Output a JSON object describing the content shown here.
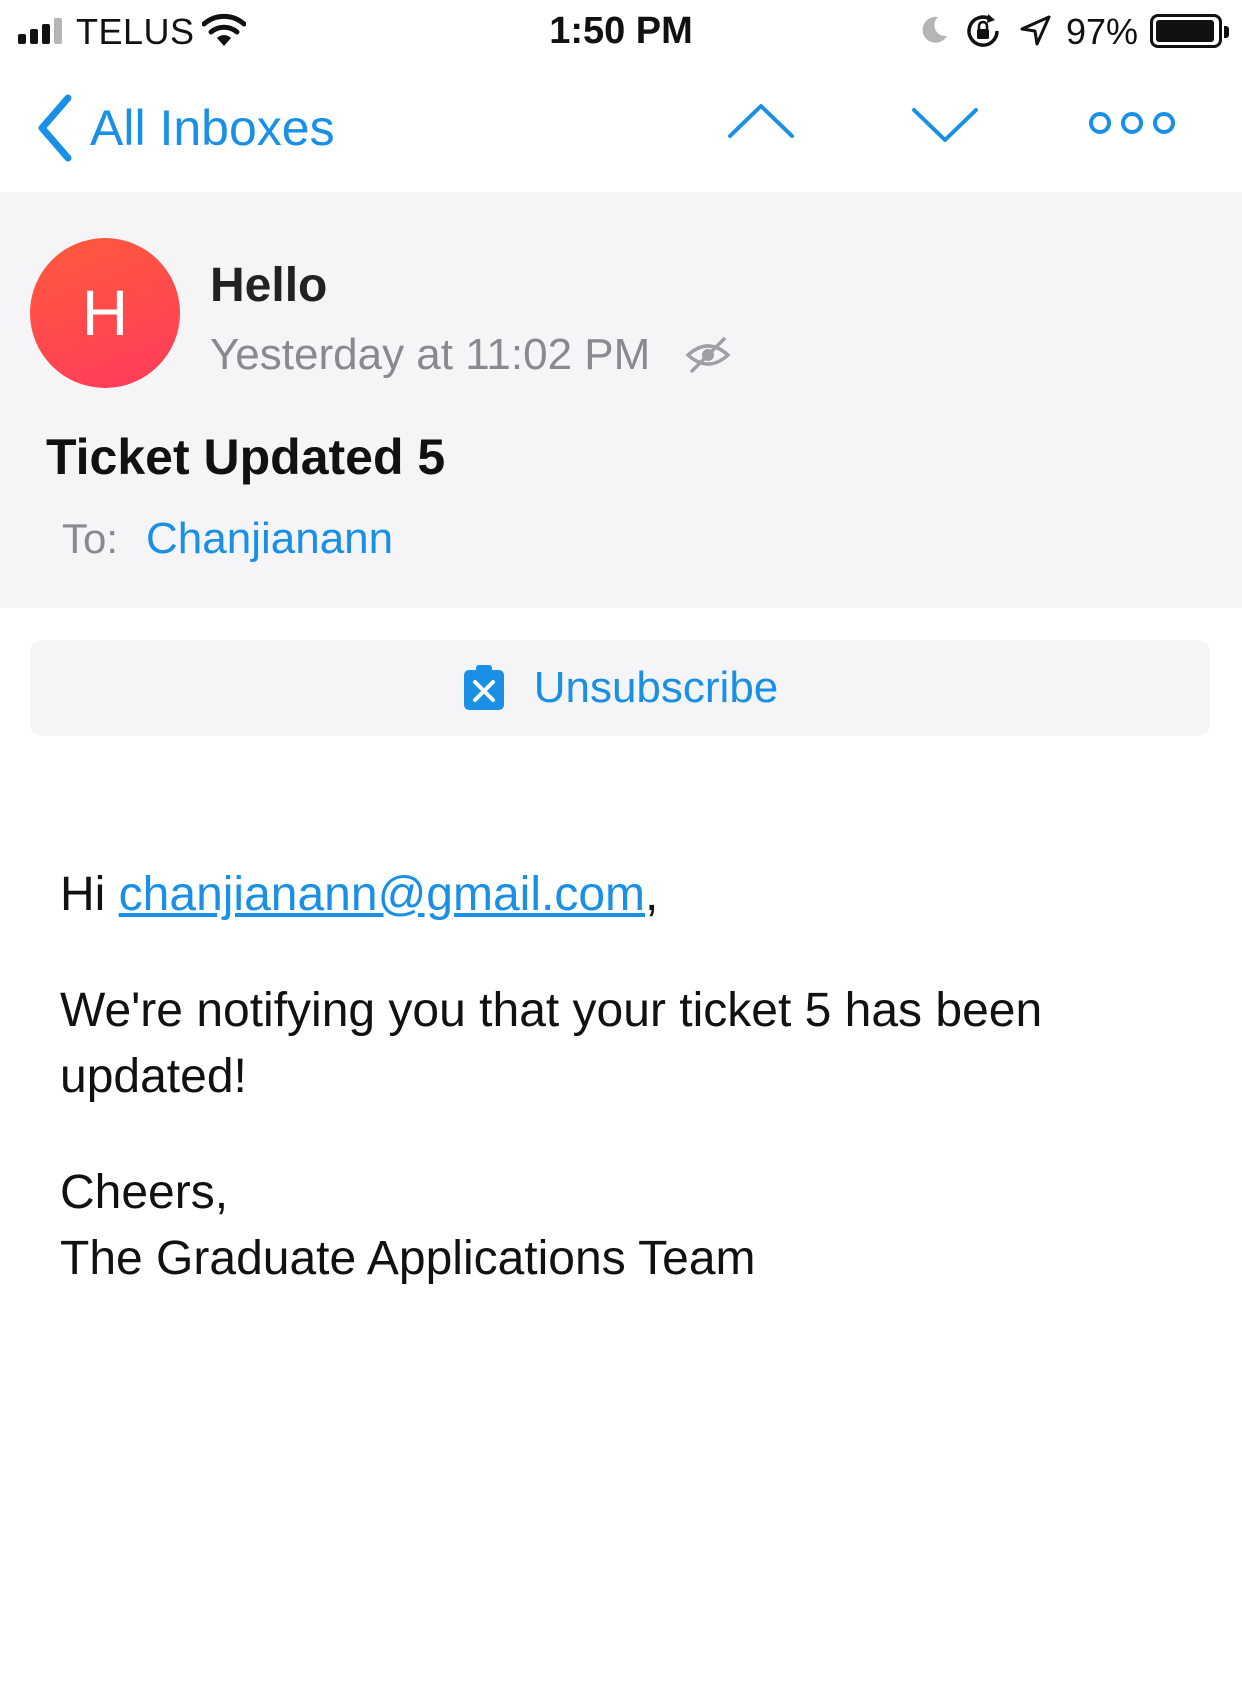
{
  "status_bar": {
    "carrier": "TELUS",
    "time": "1:50 PM",
    "battery_percent": "97%",
    "battery_level": 0.97,
    "icons": [
      "signal-icon",
      "wifi-icon",
      "moon-icon",
      "rotation-lock-icon",
      "location-arrow-icon",
      "battery-icon"
    ]
  },
  "nav": {
    "back_label": "All Inboxes",
    "icons": [
      "chevron-left-icon",
      "chevron-up-icon",
      "chevron-down-icon",
      "more-icon"
    ]
  },
  "message": {
    "avatar_letter": "H",
    "sender": "Hello",
    "date": "Yesterday at 11:02 PM",
    "subject": "Ticket Updated 5",
    "to_label": "To:",
    "to_value": "Chanjianann"
  },
  "unsubscribe": {
    "label": "Unsubscribe",
    "icon": "unsubscribe-icon"
  },
  "body": {
    "greeting_prefix": "Hi ",
    "email_link": "chanjianann@gmail.com",
    "greeting_suffix": ",",
    "paragraph": "We're notifying you that your ticket 5 has been updated!",
    "signoff": "Cheers,",
    "signature": "The Graduate Applications Team"
  },
  "colors": {
    "accent": "#1a8fe6",
    "header_bg": "#f5f5f7",
    "avatar_gradient_start": "#ff5a3c",
    "avatar_gradient_end": "#ff3b5c",
    "secondary_text": "#8a8a8e"
  }
}
